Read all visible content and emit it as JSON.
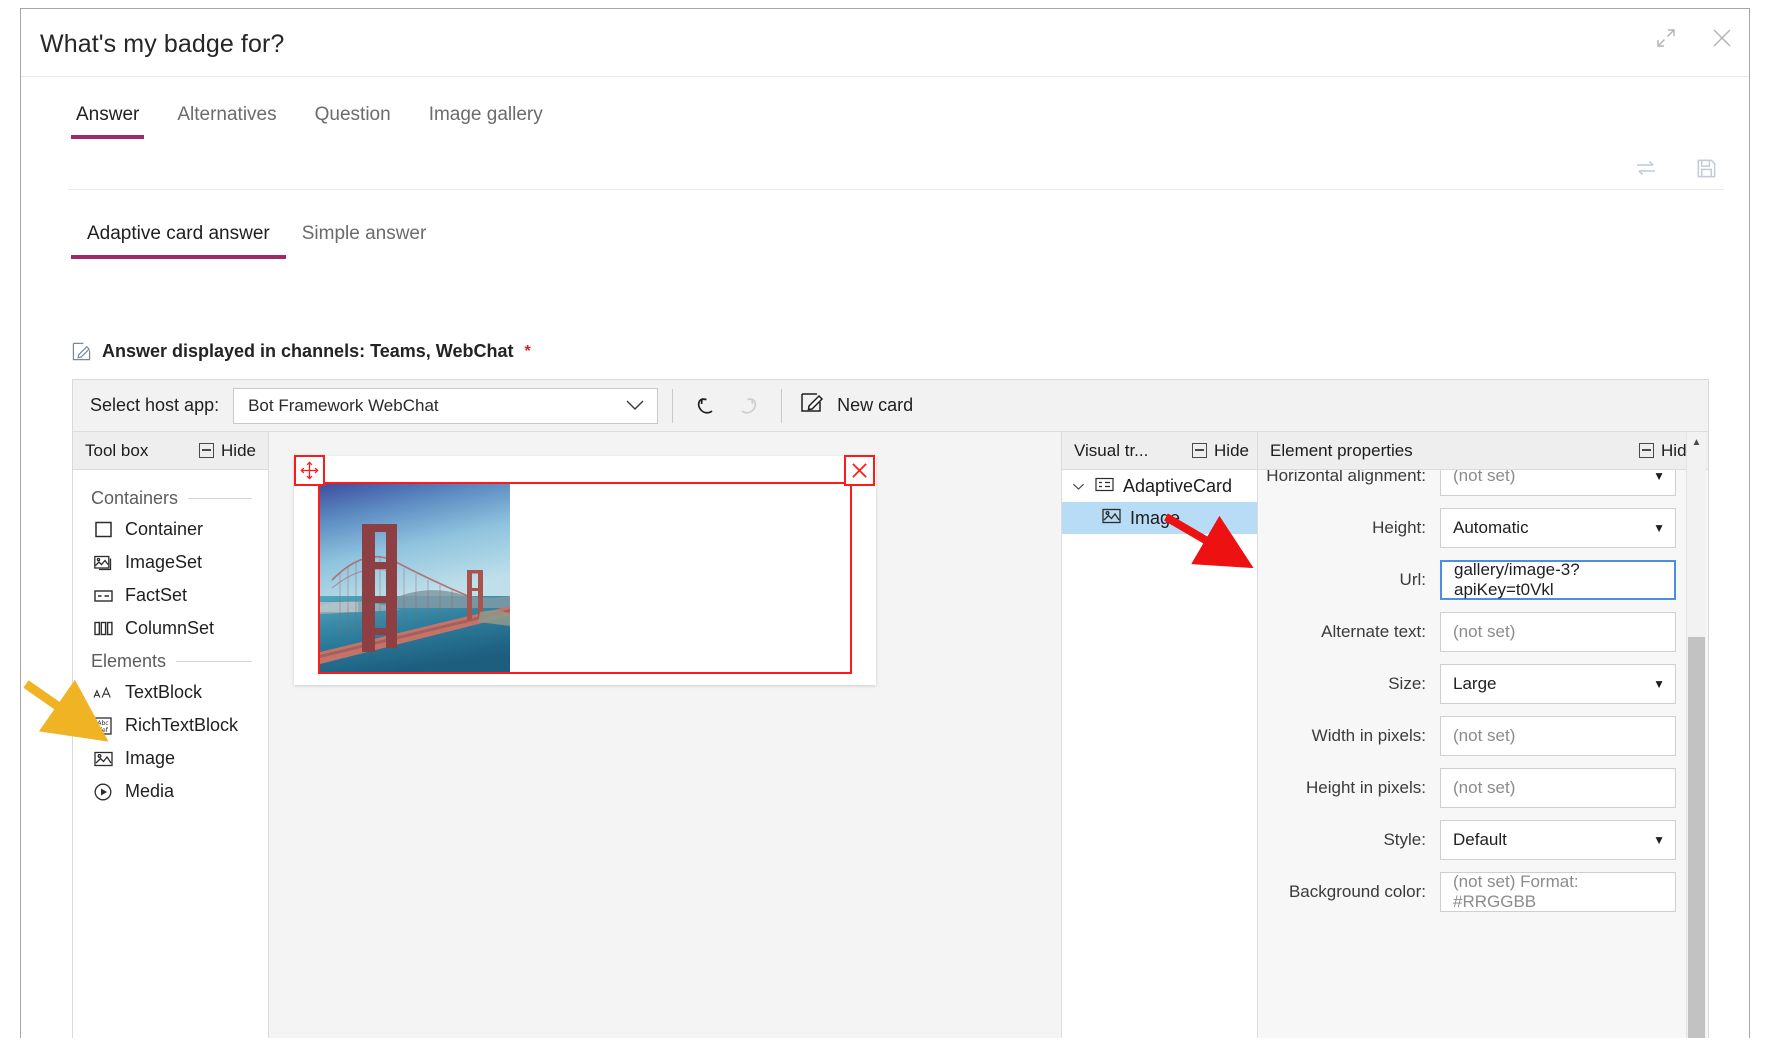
{
  "dialog": {
    "title": "What's my badge for?",
    "expand_icon": "expand-icon",
    "close_icon": "close-icon"
  },
  "tabs_level1": [
    {
      "label": "Answer",
      "active": true
    },
    {
      "label": "Alternatives",
      "active": false
    },
    {
      "label": "Question",
      "active": false
    },
    {
      "label": "Image gallery",
      "active": false
    }
  ],
  "utility_icons": [
    {
      "name": "swap-icon"
    },
    {
      "name": "save-icon"
    }
  ],
  "tabs_level2": [
    {
      "label": "Adaptive card answer",
      "active": true
    },
    {
      "label": "Simple answer",
      "active": false
    }
  ],
  "channels": {
    "icon": "edit-pencil-icon",
    "text": "Answer displayed in channels: Teams, WebChat",
    "required_marker": "*"
  },
  "toolbar": {
    "host_app_label": "Select host app:",
    "host_app_value": "Bot Framework WebChat",
    "undo_icon": "undo-icon",
    "redo_icon": "redo-icon",
    "new_card_label": "New card",
    "new_card_icon": "new-card-icon"
  },
  "toolbox": {
    "title": "Tool box",
    "hide_label": "Hide",
    "groups": [
      {
        "label": "Containers",
        "items": [
          {
            "label": "Container",
            "icon": "square-icon"
          },
          {
            "label": "ImageSet",
            "icon": "image-set-icon"
          },
          {
            "label": "FactSet",
            "icon": "fact-set-icon"
          },
          {
            "label": "ColumnSet",
            "icon": "column-set-icon"
          }
        ]
      },
      {
        "label": "Elements",
        "items": [
          {
            "label": "TextBlock",
            "icon": "text-block-icon"
          },
          {
            "label": "RichTextBlock",
            "icon": "rich-text-block-icon"
          },
          {
            "label": "Image",
            "icon": "image-icon"
          },
          {
            "label": "Media",
            "icon": "media-play-icon"
          }
        ]
      }
    ]
  },
  "preview": {
    "move_handle_icon": "move-icon",
    "delete_handle_icon": "delete-x-icon",
    "card_image_alt": "golden-gate-bridge-photo"
  },
  "visual_tree": {
    "title": "Visual tr...",
    "hide_label": "Hide",
    "nodes": [
      {
        "label": "AdaptiveCard",
        "icon": "adaptive-card-icon",
        "level": 0,
        "selected": false,
        "expanded": true
      },
      {
        "label": "Image",
        "icon": "image-icon",
        "level": 1,
        "selected": true
      }
    ]
  },
  "element_properties": {
    "title": "Element properties",
    "hide_label": "Hide",
    "rows": [
      {
        "label": "Horizontal alignment:",
        "value": "(not set)",
        "type": "select",
        "placeholder": true,
        "clipped": true
      },
      {
        "label": "Height:",
        "value": "Automatic",
        "type": "select",
        "placeholder": false
      },
      {
        "label": "Url:",
        "value": "gallery/image-3?apiKey=t0Vkl",
        "type": "text",
        "placeholder": false,
        "focused": true
      },
      {
        "label": "Alternate text:",
        "value": "(not set)",
        "type": "text",
        "placeholder": true
      },
      {
        "label": "Size:",
        "value": "Large",
        "type": "select",
        "placeholder": false
      },
      {
        "label": "Width in pixels:",
        "value": "(not set)",
        "type": "text",
        "placeholder": true
      },
      {
        "label": "Height in pixels:",
        "value": "(not set)",
        "type": "text",
        "placeholder": true
      },
      {
        "label": "Style:",
        "value": "Default",
        "type": "select",
        "placeholder": false
      },
      {
        "label": "Background color:",
        "value": "(not set) Format: #RRGGBB",
        "type": "text",
        "placeholder": true
      }
    ]
  },
  "annotations": [
    {
      "name": "yellow-arrow-to-image-tool",
      "color": "#f0b323"
    },
    {
      "name": "red-arrow-to-url-field",
      "color": "#ee1111"
    }
  ],
  "colors": {
    "accent": "#9e2a6a",
    "selection_red": "#ff1a1a",
    "tree_selected": "#b8dcf5",
    "focus_blue": "#4a90e2",
    "required_red": "#e21b1b"
  }
}
